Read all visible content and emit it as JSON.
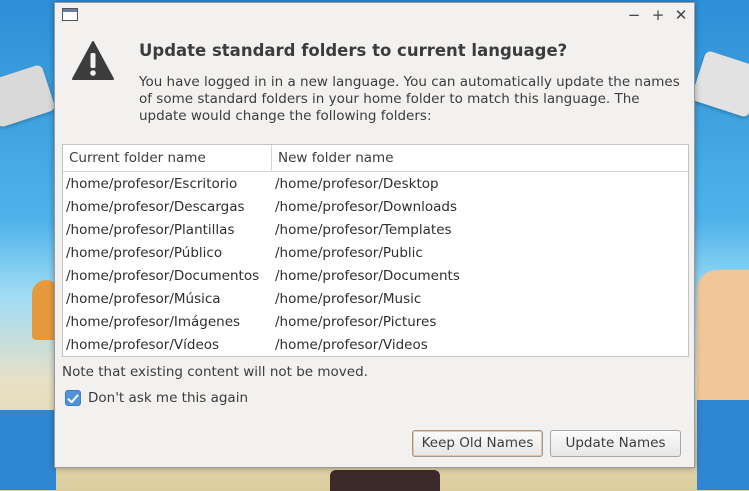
{
  "dialog": {
    "title": "Update standard folders to current language?",
    "description": "You have logged in in a new language. You can automatically update the names of some standard folders in your home folder to match this language. The update would change the following folders:",
    "titlebar_buttons": {
      "minimize": "−",
      "maximize": "+",
      "close": "✕"
    }
  },
  "table": {
    "headers": [
      "Current folder name",
      "New folder name"
    ],
    "rows": [
      [
        "/home/profesor/Escritorio",
        "/home/profesor/Desktop"
      ],
      [
        "/home/profesor/Descargas",
        "/home/profesor/Downloads"
      ],
      [
        "/home/profesor/Plantillas",
        "/home/profesor/Templates"
      ],
      [
        "/home/profesor/Público",
        "/home/profesor/Public"
      ],
      [
        "/home/profesor/Documentos",
        "/home/profesor/Documents"
      ],
      [
        "/home/profesor/Música",
        "/home/profesor/Music"
      ],
      [
        "/home/profesor/Imágenes",
        "/home/profesor/Pictures"
      ],
      [
        "/home/profesor/Vídeos",
        "/home/profesor/Videos"
      ]
    ]
  },
  "note": "Note that existing content will not be moved.",
  "checkbox": {
    "label": "Don't ask me this again",
    "checked": true
  },
  "buttons": {
    "keep": "Keep Old Names",
    "update": "Update Names"
  },
  "colors": {
    "accent": "#4f93d8",
    "warning_icon": "#3c3c3c"
  }
}
